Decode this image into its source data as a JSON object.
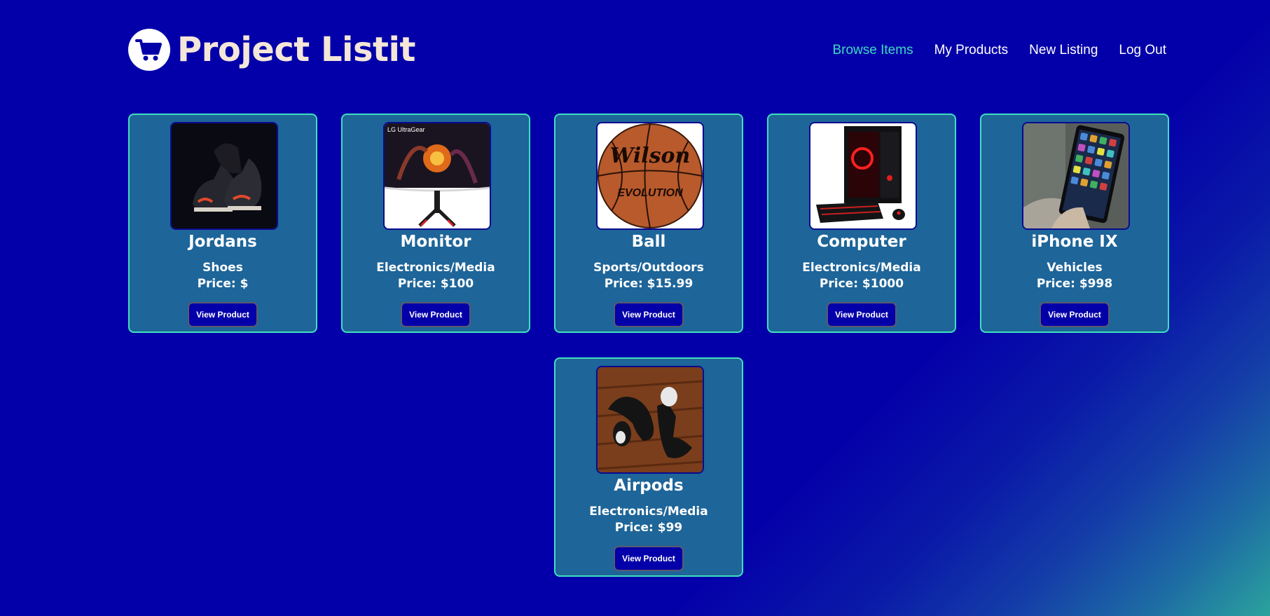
{
  "app": {
    "title": "Project Listit",
    "logo_icon": "shopping-cart-icon"
  },
  "nav": {
    "items": [
      {
        "label": "Browse Items",
        "active": true
      },
      {
        "label": "My Products",
        "active": false
      },
      {
        "label": "New Listing",
        "active": false
      },
      {
        "label": "Log Out",
        "active": false
      }
    ]
  },
  "products": [
    {
      "name": "Jordans",
      "category": "Shoes",
      "price": "Price: $",
      "button": "View Product",
      "image": "sneakers"
    },
    {
      "name": "Monitor",
      "category": "Electronics/Media",
      "price": "Price: $100",
      "button": "View Product",
      "image": "monitor"
    },
    {
      "name": "Ball",
      "category": "Sports/Outdoors",
      "price": "Price: $15.99",
      "button": "View Product",
      "image": "basketball"
    },
    {
      "name": "Computer",
      "category": "Electronics/Media",
      "price": "Price: $1000",
      "button": "View Product",
      "image": "gaming-pc"
    },
    {
      "name": "iPhone IX",
      "category": "Vehicles",
      "price": "Price: $998",
      "button": "View Product",
      "image": "tablet"
    },
    {
      "name": "Airpods",
      "category": "Electronics/Media",
      "price": "Price: $99",
      "button": "View Product",
      "image": "earbuds"
    }
  ],
  "image_text": {
    "monitor_brand": "LG UltraGear",
    "ball_brand": "Wilson",
    "ball_model": "EVOLUTION"
  },
  "colors": {
    "background": "#0400a9",
    "card": "#1e6599",
    "card_border": "#3fe0bd",
    "nav_active": "#3fd9c2",
    "brand_text": "#f4e6d8"
  }
}
